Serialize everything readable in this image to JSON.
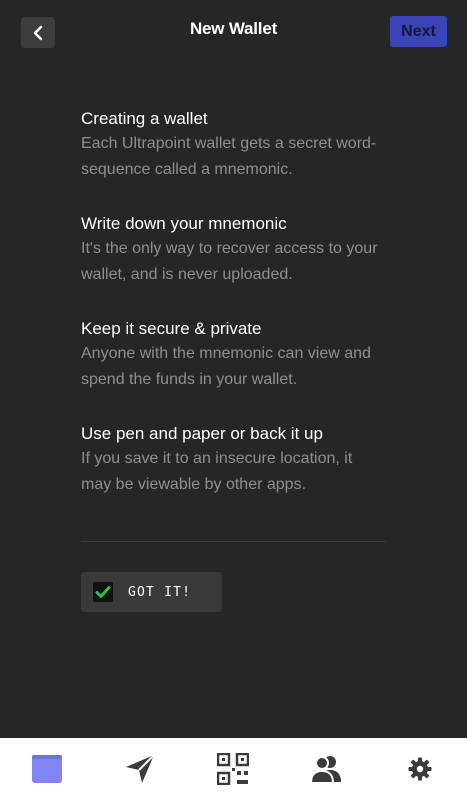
{
  "header": {
    "title": "New Wallet",
    "next_label": "Next"
  },
  "sections": [
    {
      "title": "Creating a wallet",
      "text": "Each Ultrapoint wallet gets a secret word-sequence called a mnemonic."
    },
    {
      "title": "Write down your mnemonic",
      "text": "It's the only way to recover access to your wallet, and is never uploaded."
    },
    {
      "title": "Keep it secure & private",
      "text": "Anyone with the mnemonic can view and spend the funds in your wallet."
    },
    {
      "title": "Use pen and paper or back it up",
      "text": "If you save it to an insecure location, it may be viewable by other apps."
    }
  ],
  "confirm": {
    "label": "GOT IT!",
    "checked": true
  },
  "nav": {
    "items": [
      "wallet-icon",
      "send-icon",
      "qr-code-icon",
      "contacts-icon",
      "settings-icon"
    ],
    "active": "wallet-icon"
  },
  "colors": {
    "background": "#262626",
    "accent": "#3a43b8",
    "check": "#27c24c",
    "active_nav": "#8084f4",
    "muted_text": "#8f8f8f"
  }
}
